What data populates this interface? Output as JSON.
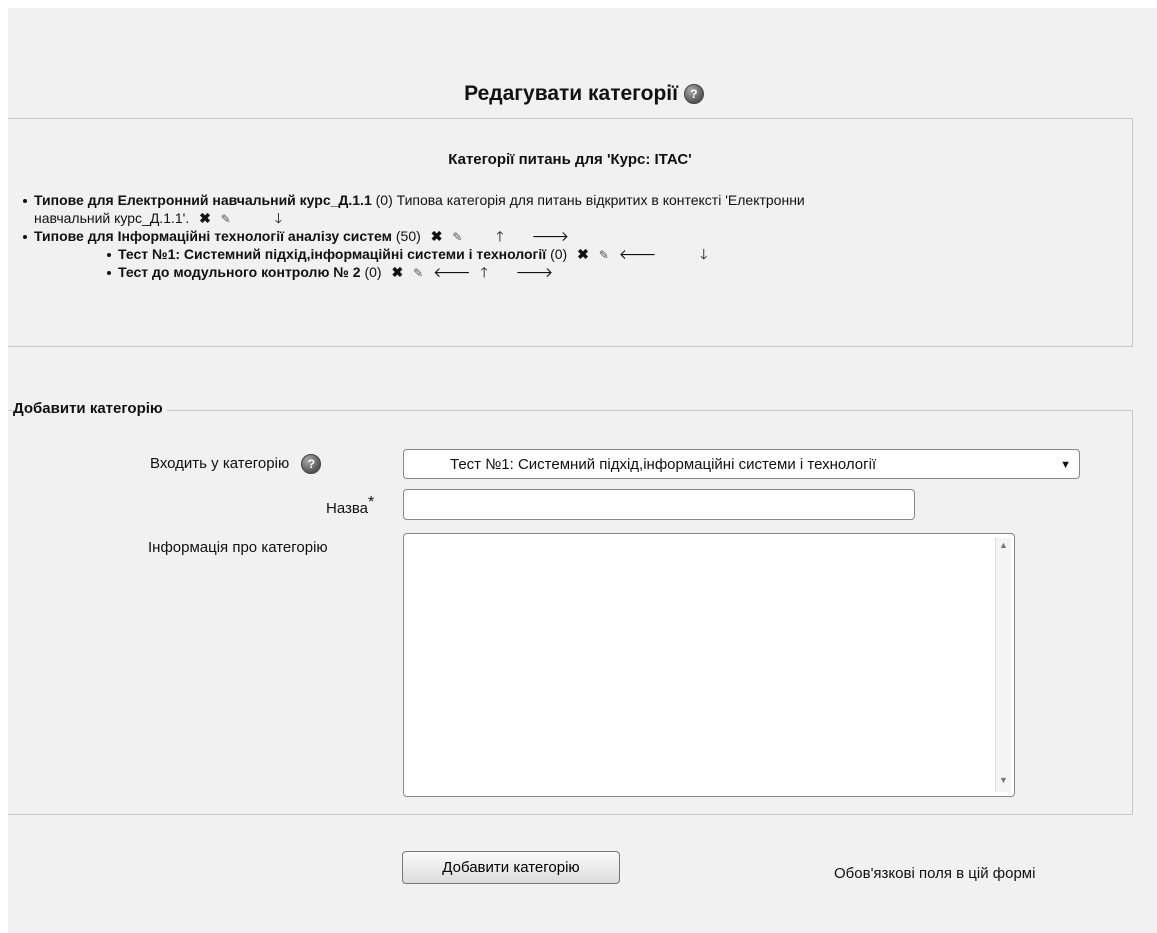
{
  "heading": "Редагувати категорії",
  "help_icon": "question-help-icon",
  "categories_title": "Категорії питань для 'Курс: ІТАС'",
  "categories": [
    {
      "name": "Типове для Електронний навчальний курс_Д.1.1",
      "count": "(0)",
      "description": "Типова категорія для питань відкритих в контексті 'Електронни",
      "description_cont": "навчальний курс_Д.1.1'."
    },
    {
      "name": "Типове для Інформаційні технології аналізу систем",
      "count": "(50)",
      "children": [
        {
          "name": "Тест №1: Системний підхід,інформаційні системи і технології",
          "count": "(0)"
        },
        {
          "name": "Тест до модульного контролю № 2",
          "count": "(0)"
        }
      ]
    }
  ],
  "icons": {
    "delete": "✖",
    "edit": "✎",
    "up": "🡑",
    "down": "🡓",
    "left": "🡐",
    "right": "🡒"
  },
  "form": {
    "legend": "Добавити категорію",
    "parent_label": "Входить у категорію",
    "parent_value": "Тест №1: Системний підхід,інформаційні системи і технології",
    "name_label": "Назва",
    "required_mark": "*",
    "info_label": "Інформація про категорію",
    "name_value": "",
    "info_value": "",
    "submit_label": "Добавити категорію",
    "required_note": "Обов'язкові поля в цій формі"
  }
}
